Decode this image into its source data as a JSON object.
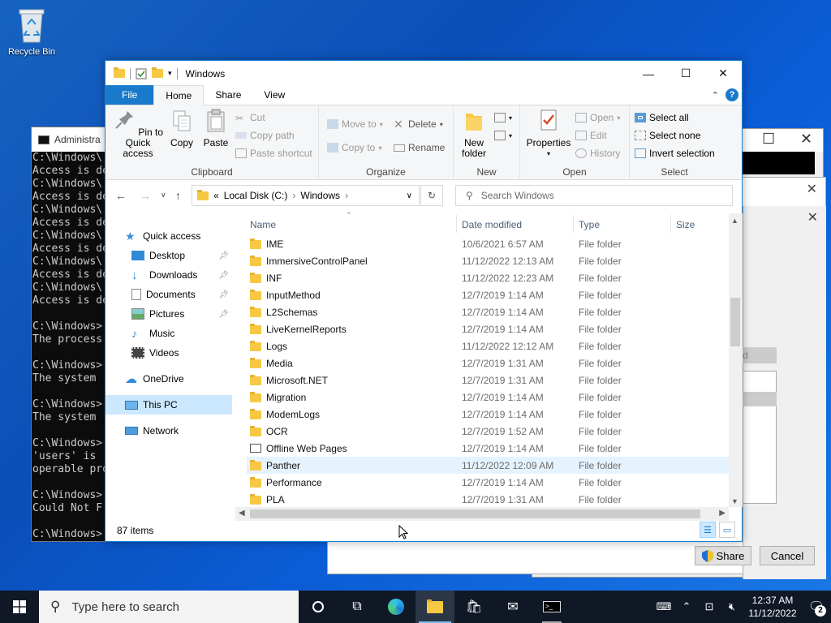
{
  "desktop": {
    "recycle_bin": "Recycle Bin"
  },
  "cmd": {
    "title": "Administra",
    "lines": [
      "C:\\Windows\\",
      "Access is de",
      "C:\\Windows\\",
      "Access is de",
      "C:\\Windows\\",
      "Access is de",
      "C:\\Windows\\",
      "Access is de",
      "C:\\Windows\\",
      "Access is de",
      "C:\\Windows\\",
      "Access is de",
      "",
      "C:\\Windows>",
      "The process",
      "",
      "C:\\Windows>",
      "The system",
      "",
      "C:\\Windows>",
      "The system",
      "",
      "C:\\Windows>",
      "'users' is",
      "operable pro",
      "",
      "C:\\Windows>",
      "Could Not F",
      "",
      "C:\\Windows>"
    ]
  },
  "share_dialog": {
    "share_label": "Share",
    "cancel_label": "Cancel",
    "grey_label": "d"
  },
  "explorer": {
    "title": "Windows",
    "tabs": [
      "File",
      "Home",
      "Share",
      "View"
    ],
    "clipboard": {
      "pin": "Pin to Quick access",
      "copy": "Copy",
      "paste": "Paste",
      "cut": "Cut",
      "copy_path": "Copy path",
      "paste_shortcut": "Paste shortcut",
      "label": "Clipboard"
    },
    "organize": {
      "move_to": "Move to",
      "copy_to": "Copy to",
      "delete": "Delete",
      "rename": "Rename",
      "label": "Organize"
    },
    "new": {
      "new_folder": "New folder",
      "label": "New"
    },
    "open": {
      "properties": "Properties",
      "open": "Open",
      "edit": "Edit",
      "history": "History",
      "label": "Open"
    },
    "select": {
      "select_all": "Select all",
      "select_none": "Select none",
      "invert": "Invert selection",
      "label": "Select"
    },
    "address": {
      "root": "«",
      "disk": "Local Disk (C:)",
      "folder": "Windows"
    },
    "search_placeholder": "Search Windows",
    "nav": [
      {
        "label": "Quick access"
      },
      {
        "label": "Desktop"
      },
      {
        "label": "Downloads"
      },
      {
        "label": "Documents"
      },
      {
        "label": "Pictures"
      },
      {
        "label": "Music"
      },
      {
        "label": "Videos"
      },
      {
        "label": "OneDrive"
      },
      {
        "label": "This PC"
      },
      {
        "label": "Network"
      }
    ],
    "columns": {
      "name": "Name",
      "date": "Date modified",
      "type": "Type",
      "size": "Size"
    },
    "rows": [
      {
        "name": "IME",
        "date": "10/6/2021 6:57 AM",
        "type": "File folder"
      },
      {
        "name": "ImmersiveControlPanel",
        "date": "11/12/2022 12:13 AM",
        "type": "File folder"
      },
      {
        "name": "INF",
        "date": "11/12/2022 12:23 AM",
        "type": "File folder"
      },
      {
        "name": "InputMethod",
        "date": "12/7/2019 1:14 AM",
        "type": "File folder"
      },
      {
        "name": "L2Schemas",
        "date": "12/7/2019 1:14 AM",
        "type": "File folder"
      },
      {
        "name": "LiveKernelReports",
        "date": "12/7/2019 1:14 AM",
        "type": "File folder"
      },
      {
        "name": "Logs",
        "date": "11/12/2022 12:12 AM",
        "type": "File folder"
      },
      {
        "name": "Media",
        "date": "12/7/2019 1:31 AM",
        "type": "File folder"
      },
      {
        "name": "Microsoft.NET",
        "date": "12/7/2019 1:31 AM",
        "type": "File folder"
      },
      {
        "name": "Migration",
        "date": "12/7/2019 1:14 AM",
        "type": "File folder"
      },
      {
        "name": "ModemLogs",
        "date": "12/7/2019 1:14 AM",
        "type": "File folder"
      },
      {
        "name": "OCR",
        "date": "12/7/2019 1:52 AM",
        "type": "File folder"
      },
      {
        "name": "Offline Web Pages",
        "date": "12/7/2019 1:14 AM",
        "type": "File folder"
      },
      {
        "name": "Panther",
        "date": "11/12/2022 12:09 AM",
        "type": "File folder"
      },
      {
        "name": "Performance",
        "date": "12/7/2019 1:14 AM",
        "type": "File folder"
      },
      {
        "name": "PLA",
        "date": "12/7/2019 1:31 AM",
        "type": "File folder"
      }
    ],
    "status": "87 items"
  },
  "taskbar": {
    "search_placeholder": "Type here to search",
    "time": "12:37 AM",
    "date": "11/12/2022",
    "notifications": "2"
  }
}
